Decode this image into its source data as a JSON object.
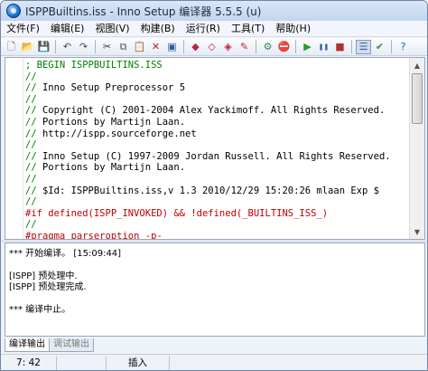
{
  "window": {
    "title": "ISPPBuiltins.iss - Inno Setup 编译器 5.5.5 (u)"
  },
  "menu": [
    "文件(F)",
    "编辑(E)",
    "视图(V)",
    "构建(B)",
    "运行(R)",
    "工具(T)",
    "帮助(H)"
  ],
  "toolbar": {
    "buttons": [
      {
        "name": "new-file-icon",
        "glyph": "🗋",
        "color": "#555555"
      },
      {
        "name": "open-file-icon",
        "glyph": "📂",
        "color": "#c9a227"
      },
      {
        "name": "save-icon",
        "glyph": "💾",
        "color": "#2a4f9e"
      },
      {
        "sep": true
      },
      {
        "name": "undo-icon",
        "glyph": "↶",
        "color": "#4a4a4a"
      },
      {
        "name": "redo-icon",
        "glyph": "↷",
        "color": "#4a4a4a"
      },
      {
        "sep": true
      },
      {
        "name": "cut-icon",
        "glyph": "✂",
        "color": "#333333"
      },
      {
        "name": "copy-icon",
        "glyph": "⧉",
        "color": "#555555"
      },
      {
        "name": "paste-icon",
        "glyph": "📋",
        "color": "#8a6d3b"
      },
      {
        "name": "delete-icon",
        "glyph": "✕",
        "color": "#c02020"
      },
      {
        "name": "select-all-icon",
        "glyph": "▣",
        "color": "#2f5aa8"
      },
      {
        "sep": true
      },
      {
        "name": "find-icon",
        "glyph": "◆",
        "color": "#c02040"
      },
      {
        "name": "find-next-icon",
        "glyph": "◇",
        "color": "#c02040"
      },
      {
        "name": "replace-icon",
        "glyph": "◈",
        "color": "#c02040"
      },
      {
        "name": "goto-line-icon",
        "glyph": "✎",
        "color": "#c02040"
      },
      {
        "sep": true
      },
      {
        "name": "compile-icon",
        "glyph": "⚙",
        "color": "#2e8b57"
      },
      {
        "name": "stop-compile-icon",
        "glyph": "⛔",
        "color": "#b03030"
      },
      {
        "sep": true
      },
      {
        "name": "run-icon",
        "glyph": "▶",
        "color": "#1f9a2f"
      },
      {
        "name": "pause-icon",
        "glyph": "❚❚",
        "color": "#3a5a99"
      },
      {
        "name": "terminate-icon",
        "glyph": "■",
        "color": "#b03030"
      },
      {
        "sep": true
      },
      {
        "name": "options-icon",
        "glyph": "☰",
        "color": "#3a5a99",
        "active": true
      },
      {
        "name": "wizard-icon",
        "glyph": "✔",
        "color": "#2e8b57"
      },
      {
        "sep": true
      },
      {
        "name": "help-icon",
        "glyph": "?",
        "color": "#1f5fbf"
      }
    ]
  },
  "editor": {
    "lines": [
      {
        "text": "; BEGIN ISPPBUILTINS.ISS",
        "type": "comment",
        "prefix": ""
      },
      {
        "text": "//",
        "type": "comment",
        "prefix": ""
      },
      {
        "text": "// Inno Setup Preprocessor 5",
        "type": "plain",
        "prefix": "//"
      },
      {
        "text": "//",
        "type": "comment",
        "prefix": ""
      },
      {
        "text": "// Copyright (C) 2001-2004 Alex Yackimoff. All Rights Reserved.",
        "type": "plain",
        "prefix": "//"
      },
      {
        "text": "// Portions by Martijn Laan.",
        "type": "plain",
        "prefix": "//"
      },
      {
        "text": "// http://ispp.sourceforge.net",
        "type": "plain",
        "prefix": "//"
      },
      {
        "text": "//",
        "type": "comment",
        "prefix": ""
      },
      {
        "text": "// Inno Setup (C) 1997-2009 Jordan Russell. All Rights Reserved.",
        "type": "plain",
        "prefix": "//"
      },
      {
        "text": "// Portions by Martijn Laan.",
        "type": "plain",
        "prefix": "//"
      },
      {
        "text": "//",
        "type": "comment",
        "prefix": ""
      },
      {
        "text": "// $Id: ISPPBuiltins.iss,v 1.3 2010/12/29 15:20:26 mlaan Exp $",
        "type": "plain",
        "prefix": "//"
      },
      {
        "text": "//",
        "type": "comment",
        "prefix": ""
      },
      {
        "text": "#if defined(ISPP_INVOKED) && !defined(_BUILTINS_ISS_)",
        "type": "preproc",
        "prefix": ""
      },
      {
        "text": "//",
        "type": "comment",
        "prefix": ""
      },
      {
        "text": "#pragma parseroption -p-",
        "type": "preproc",
        "prefix": ""
      }
    ]
  },
  "output": {
    "lines": [
      "*** 开始编译。 [15:09:44]",
      "",
      "[ISPP] 预处理中.",
      "[ISPP] 预处理完成.",
      "",
      "*** 编译中止。"
    ]
  },
  "tabs": [
    {
      "label": "编译输出",
      "active": true
    },
    {
      "label": "调试输出",
      "active": false
    }
  ],
  "status": {
    "position": "7:  42",
    "modified": "",
    "insert_mode": "插入",
    "message": ""
  }
}
